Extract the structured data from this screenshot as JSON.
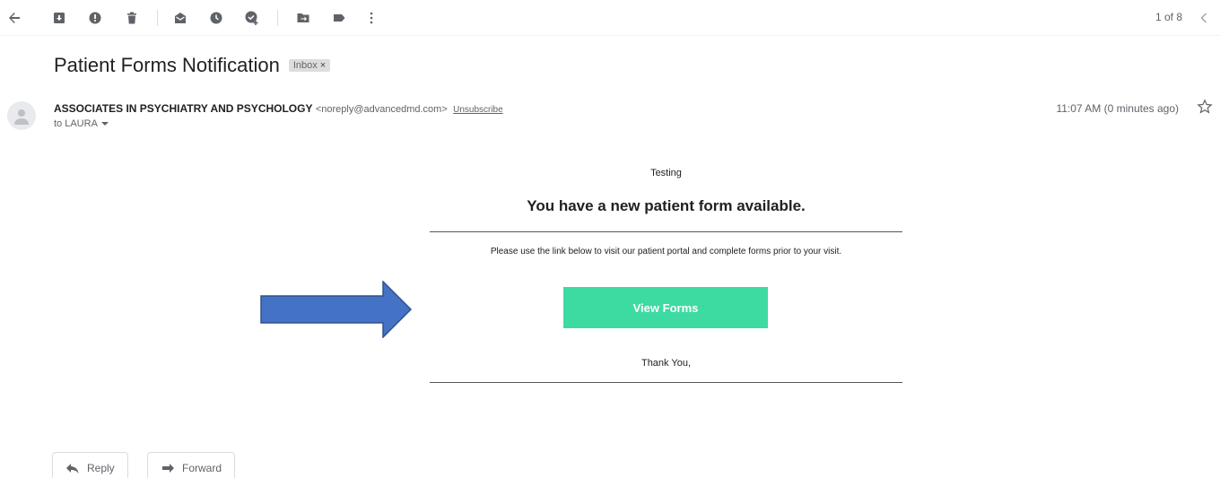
{
  "toolbar": {
    "icons": [
      "back-arrow-icon",
      "archive-icon",
      "report-spam-icon",
      "delete-icon",
      "mark-unread-icon",
      "snooze-icon",
      "add-to-tasks-icon",
      "move-to-icon",
      "labels-icon",
      "more-icon"
    ],
    "pager": "1 of 8"
  },
  "email": {
    "subject": "Patient Forms Notification",
    "label": "Inbox",
    "label_remove": "×",
    "sender_name": "ASSOCIATES IN PSYCHIATRY AND PSYCHOLOGY",
    "sender_email": "<noreply@advancedmd.com>",
    "unsubscribe": "Unsubscribe",
    "to": "to LAURA",
    "time": "11:07 AM (0 minutes ago)"
  },
  "body": {
    "testing": "Testing",
    "headline": "You have a new patient form available.",
    "instructions": "Please use the link below to visit our patient portal and complete forms prior to your visit.",
    "button": "View Forms",
    "thanks": "Thank You,"
  },
  "actions": {
    "reply": "Reply",
    "forward": "Forward"
  },
  "colors": {
    "button": "#3ddba2",
    "arrow_fill": "#4472c4",
    "arrow_stroke": "#2f528f"
  }
}
